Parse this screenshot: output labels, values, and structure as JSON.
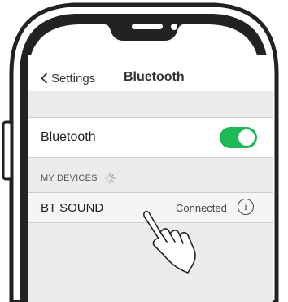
{
  "nav": {
    "back_label": "Settings",
    "title": "Bluetooth"
  },
  "bluetooth": {
    "label": "Bluetooth",
    "enabled": true,
    "toggle_color": "#1db954"
  },
  "devices_section": {
    "header": "MY DEVICES",
    "searching": true,
    "items": [
      {
        "name": "BT SOUND",
        "status": "Connected",
        "info_glyph": "i"
      }
    ]
  },
  "icons": [
    "back-chevron-icon",
    "loading-spinner-icon",
    "info-icon",
    "pointing-hand-icon",
    "camera-icon",
    "speaker-icon"
  ]
}
